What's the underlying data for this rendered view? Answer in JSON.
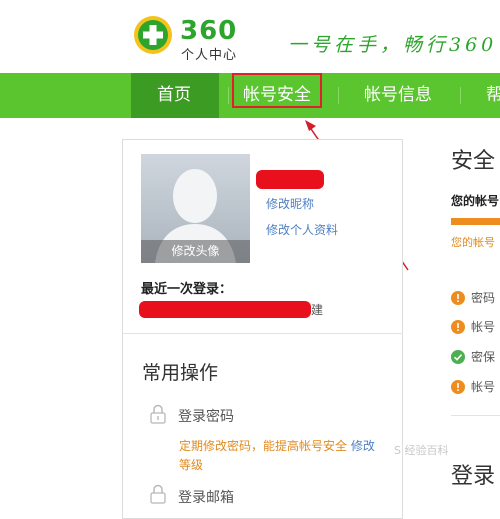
{
  "brand": {
    "logo_number": "360",
    "logo_subtitle": "个人中心",
    "slogan": "一号在手，畅行360",
    "brand_color": "#2da52d"
  },
  "nav": {
    "items": [
      {
        "label": "首页",
        "active": true
      },
      {
        "label": "帐号安全",
        "highlighted": true
      },
      {
        "label": "帐号信息"
      },
      {
        "label": "帮"
      }
    ],
    "bar_color": "#5ac52e",
    "active_color": "#3c9b22"
  },
  "profile": {
    "avatar_caption": "修改头像",
    "edit_nickname": "修改昵称",
    "edit_profile": "修改个人资料",
    "last_login_label": "最近一次登录：",
    "last_login_suffix": "建"
  },
  "operations": {
    "title": "常用操作",
    "items": [
      {
        "label": "登录密码",
        "description": "定期修改密码，能提高帐号安全",
        "description_tail": "等级",
        "action": "修改",
        "icon": "lock-icon"
      },
      {
        "label": "登录邮箱",
        "icon": "lock-icon"
      }
    ]
  },
  "security": {
    "title": "安全",
    "level_label": "您的帐号",
    "level_note": "您的帐号",
    "statuses": [
      {
        "text": "密码",
        "icon": "warning-icon",
        "color": "#ee8d1f"
      },
      {
        "text": "帐号",
        "icon": "warning-icon",
        "color": "#ee8d1f"
      },
      {
        "text": "密保",
        "icon": "check-icon",
        "color": "#4caf50"
      },
      {
        "text": "帐号",
        "icon": "warning-icon",
        "color": "#ee8d1f"
      }
    ],
    "login_title": "登录"
  },
  "watermark": "S 经验百科"
}
